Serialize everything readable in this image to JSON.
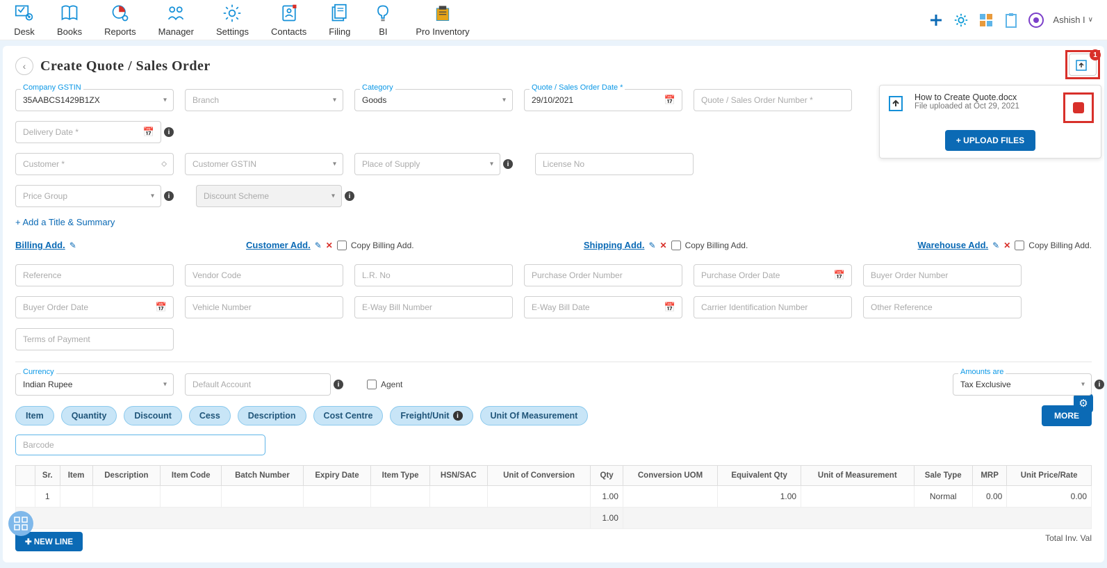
{
  "nav": [
    "Desk",
    "Books",
    "Reports",
    "Manager",
    "Settings",
    "Contacts",
    "Filing",
    "BI",
    "Pro Inventory"
  ],
  "user": "Ashish I",
  "page_title": "Create Quote / Sales Order",
  "attach_badge": "1",
  "upload": {
    "name": "How to Create Quote.docx",
    "meta": "File uploaded at Oct 29, 2021",
    "btn": "+ UPLOAD FILES"
  },
  "labels": {
    "gstin": "Company GSTIN",
    "branch": "Branch",
    "category": "Category",
    "qdate": "Quote / Sales Order Date *",
    "qnum": "Quote / Sales Order Number *",
    "delivery": "Delivery Date *",
    "customer": "Customer *",
    "cgstin": "Customer GSTIN",
    "place": "Place of Supply",
    "license": "License No",
    "pricegrp": "Price Group",
    "discount": "Discount Scheme",
    "addtitle": "+ Add a Title & Summary",
    "billing": "Billing Add.",
    "customeradd": "Customer Add.",
    "shipping": "Shipping Add.",
    "warehouse": "Warehouse Add.",
    "copybill": "Copy Billing Add.",
    "reference": "Reference",
    "vendor": "Vendor Code",
    "lr": "L.R. No",
    "po": "Purchase Order Number",
    "podate": "Purchase Order Date",
    "buyerorder": "Buyer Order Number",
    "buyerdate": "Buyer Order Date",
    "vehicle": "Vehicle Number",
    "eway": "E-Way Bill Number",
    "ewaydate": "E-Way Bill Date",
    "carrier": "Carrier Identification Number",
    "otherref": "Other Reference",
    "terms": "Terms of Payment",
    "currency": "Currency",
    "account": "Default Account",
    "agent": "Agent",
    "amounts": "Amounts are",
    "taxexc": "Tax Exclusive",
    "barcode": "Barcode",
    "more": "MORE",
    "newline": "NEW LINE",
    "totalinv": "Total Inv. Val"
  },
  "vals": {
    "gstin": "35AABCS1429B1ZX",
    "category": "Goods",
    "qdate": "29/10/2021",
    "currency": "Indian Rupee"
  },
  "pills": [
    "Item",
    "Quantity",
    "Discount",
    "Cess",
    "Description",
    "Cost Centre",
    "Freight/Unit",
    "Unit Of Measurement"
  ],
  "freight_info": "ⓘ",
  "cols": [
    "Sr.",
    "Item",
    "Description",
    "Item Code",
    "Batch Number",
    "Expiry Date",
    "Item Type",
    "HSN/SAC",
    "Unit of Conversion",
    "Qty",
    "Conversion UOM",
    "Equivalent Qty",
    "Unit of Measurement",
    "Sale Type",
    "MRP",
    "Unit Price/Rate"
  ],
  "row": {
    "sr": "1",
    "qty": "1.00",
    "eqty": "1.00",
    "saletype": "Normal",
    "mrp": "0.00",
    "rate": "0.00"
  },
  "foot_qty": "1.00"
}
